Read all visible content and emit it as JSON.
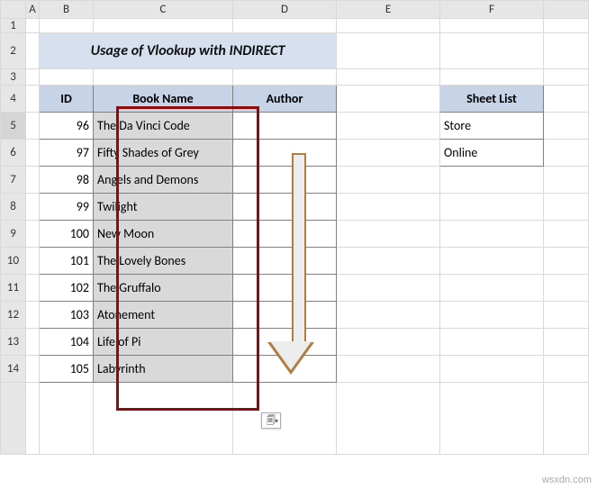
{
  "columns": [
    "A",
    "B",
    "C",
    "D",
    "E",
    "F"
  ],
  "rows": [
    "1",
    "2",
    "3",
    "4",
    "5",
    "6",
    "7",
    "8",
    "9",
    "10",
    "11",
    "12",
    "13",
    "14"
  ],
  "title": "Usage of Vlookup with INDIRECT",
  "headers": {
    "id": "ID",
    "book": "Book Name",
    "author": "Author",
    "sheetlist": "Sheet List"
  },
  "data": [
    {
      "id": "96",
      "book": "The Da Vinci Code"
    },
    {
      "id": "97",
      "book": "Fifty Shades of Grey"
    },
    {
      "id": "98",
      "book": "Angels and Demons"
    },
    {
      "id": "99",
      "book": "Twilight"
    },
    {
      "id": "100",
      "book": "New Moon"
    },
    {
      "id": "101",
      "book": "The Lovely Bones"
    },
    {
      "id": "102",
      "book": "The Gruffalo"
    },
    {
      "id": "103",
      "book": "Atonement"
    },
    {
      "id": "104",
      "book": "Life of Pi"
    },
    {
      "id": "105",
      "book": "Labyrinth"
    }
  ],
  "sheetlist": [
    "Store",
    "Online"
  ],
  "watermark": "wsxdn.com"
}
